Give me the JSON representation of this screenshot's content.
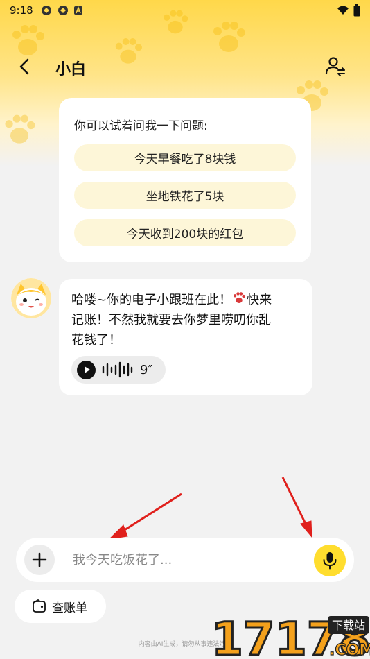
{
  "status_bar": {
    "time": "9:18"
  },
  "header": {
    "title": "小白"
  },
  "suggestions": {
    "title": "你可以试着问我一下问题:",
    "items": [
      "今天早餐吃了8块钱",
      "坐地铁花了5块",
      "今天收到200块的红包"
    ]
  },
  "message": {
    "line1": "哈喽~你的电子小跟班在此！",
    "line1b": "快来",
    "line2": "记账！不然我就要去你梦里唠叨你乱",
    "line3": "花钱了！",
    "voice_duration": "9″"
  },
  "input_bar": {
    "placeholder": "我今天吃饭花了..."
  },
  "bill_button": {
    "label": "查账单"
  },
  "footer": {
    "disclaimer": "内容由AI生成，请勿从事违法活动"
  },
  "watermark": {
    "number": "17178",
    "site_label": "下载站",
    "domain": ".COM"
  },
  "colors": {
    "accent_yellow": "#ffdd2e",
    "chip_bg": "#fdf6d8",
    "arrow_red": "#e0201c"
  }
}
